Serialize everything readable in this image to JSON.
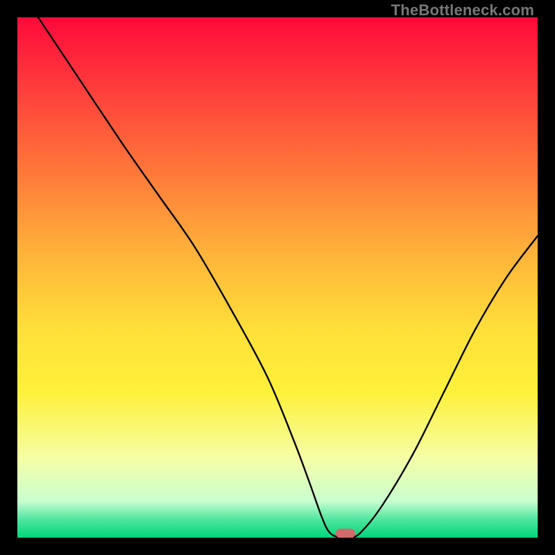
{
  "watermark": "TheBottleneck.com",
  "chart_data": {
    "type": "line",
    "title": "",
    "xlabel": "",
    "ylabel": "",
    "xlim": [
      0,
      100
    ],
    "ylim": [
      0,
      100
    ],
    "grid": false,
    "legend": false,
    "background": {
      "stops": [
        {
          "pos": 0.0,
          "color": "#ff0a3a"
        },
        {
          "pos": 0.14,
          "color": "#ff3f3c"
        },
        {
          "pos": 0.3,
          "color": "#ff7a3a"
        },
        {
          "pos": 0.45,
          "color": "#ffb23a"
        },
        {
          "pos": 0.6,
          "color": "#ffe03a"
        },
        {
          "pos": 0.72,
          "color": "#fff13a"
        },
        {
          "pos": 0.85,
          "color": "#f5ffa8"
        },
        {
          "pos": 0.93,
          "color": "#c8ffd0"
        },
        {
          "pos": 0.965,
          "color": "#50e6a0"
        },
        {
          "pos": 1.0,
          "color": "#00d77a"
        }
      ]
    },
    "series": [
      {
        "name": "bottleneck-curve",
        "color": "#000000",
        "x": [
          4,
          10,
          20,
          27,
          34,
          41,
          48,
          53,
          56,
          58.5,
          60,
          62,
          64,
          66,
          70,
          76,
          82,
          88,
          94,
          100
        ],
        "y": [
          100,
          91,
          76,
          66,
          56,
          44,
          31,
          19,
          11,
          4,
          1,
          0,
          0,
          1,
          6,
          16,
          28,
          40,
          50,
          58
        ]
      }
    ],
    "marker": {
      "x": 63,
      "y": 0.8,
      "color": "#d46a6a",
      "shape": "rounded-rect"
    }
  }
}
